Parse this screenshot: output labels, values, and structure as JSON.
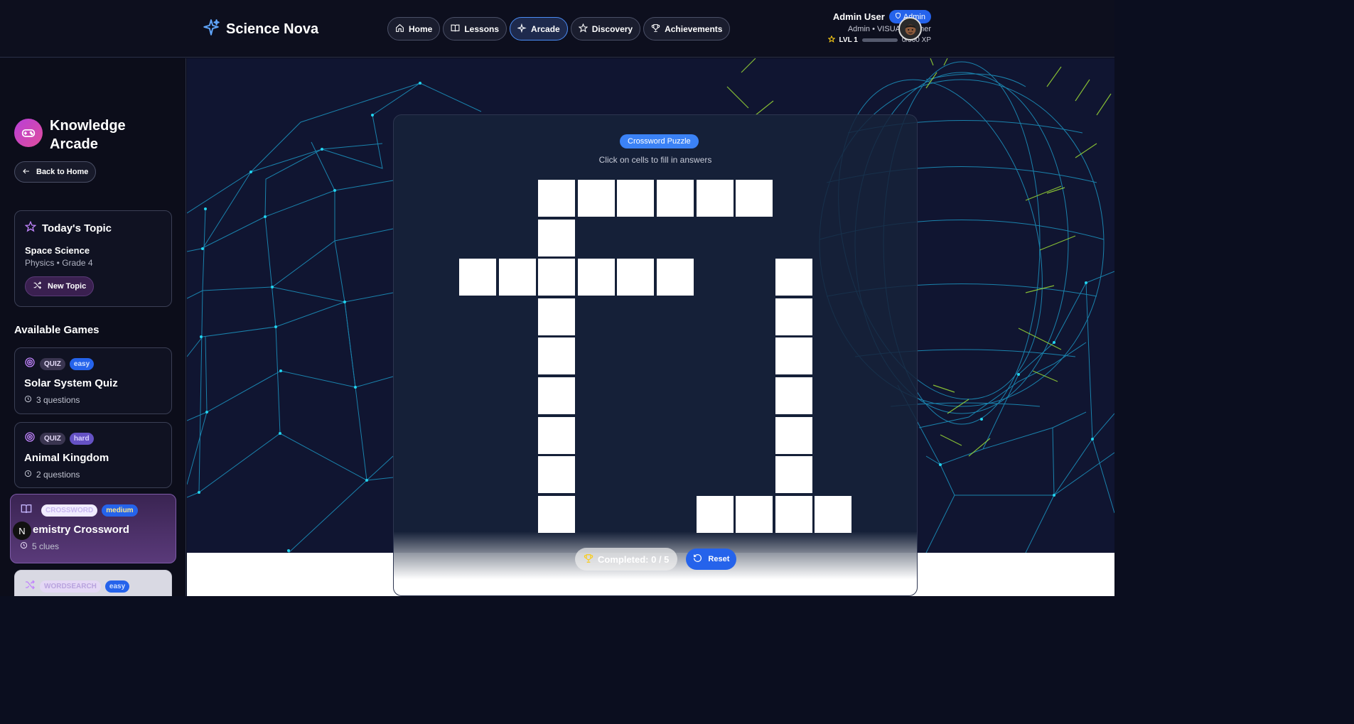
{
  "header": {
    "brand": "Science Nova",
    "nav": [
      {
        "label": "Home",
        "icon": "home-icon"
      },
      {
        "label": "Lessons",
        "icon": "book-icon"
      },
      {
        "label": "Arcade",
        "icon": "sparkles-icon",
        "active": true
      },
      {
        "label": "Discovery",
        "icon": "star-icon"
      },
      {
        "label": "Achievements",
        "icon": "trophy-icon"
      }
    ],
    "user": {
      "name": "Admin User",
      "badge": "Admin",
      "role": "Admin • VISUAL learner",
      "level": "LVL 1",
      "xp": "0/500 XP",
      "xp_progress": 0
    }
  },
  "sidebar": {
    "title": "Knowledge Arcade",
    "back_label": "Back to Home",
    "topic": {
      "heading": "Today's Topic",
      "name": "Space Science",
      "sub": "Physics • Grade 4",
      "new_label": "New Topic"
    },
    "games_heading": "Available Games",
    "games": [
      {
        "type": "QUIZ",
        "difficulty": "easy",
        "name": "Solar System Quiz",
        "meta": "3 questions"
      },
      {
        "type": "QUIZ",
        "difficulty": "hard",
        "name": "Animal Kingdom",
        "meta": "2 questions"
      },
      {
        "type": "CROSSWORD",
        "difficulty": "medium",
        "name": "emistry Crossword",
        "meta": "5 clues"
      },
      {
        "type": "WORDSEARCH",
        "difficulty": "easy"
      }
    ],
    "n_badge": "N"
  },
  "puzzle": {
    "badge": "Crossword Puzzle",
    "instruction": "Click on cells to fill in answers",
    "completed": "Completed: 0 / 5",
    "reset_label": "Reset"
  },
  "colors": {
    "accent": "#2563eb",
    "header_bg": "#0d0f1e",
    "main_bg": "#101531",
    "grid_line": "#1ea7d6"
  }
}
